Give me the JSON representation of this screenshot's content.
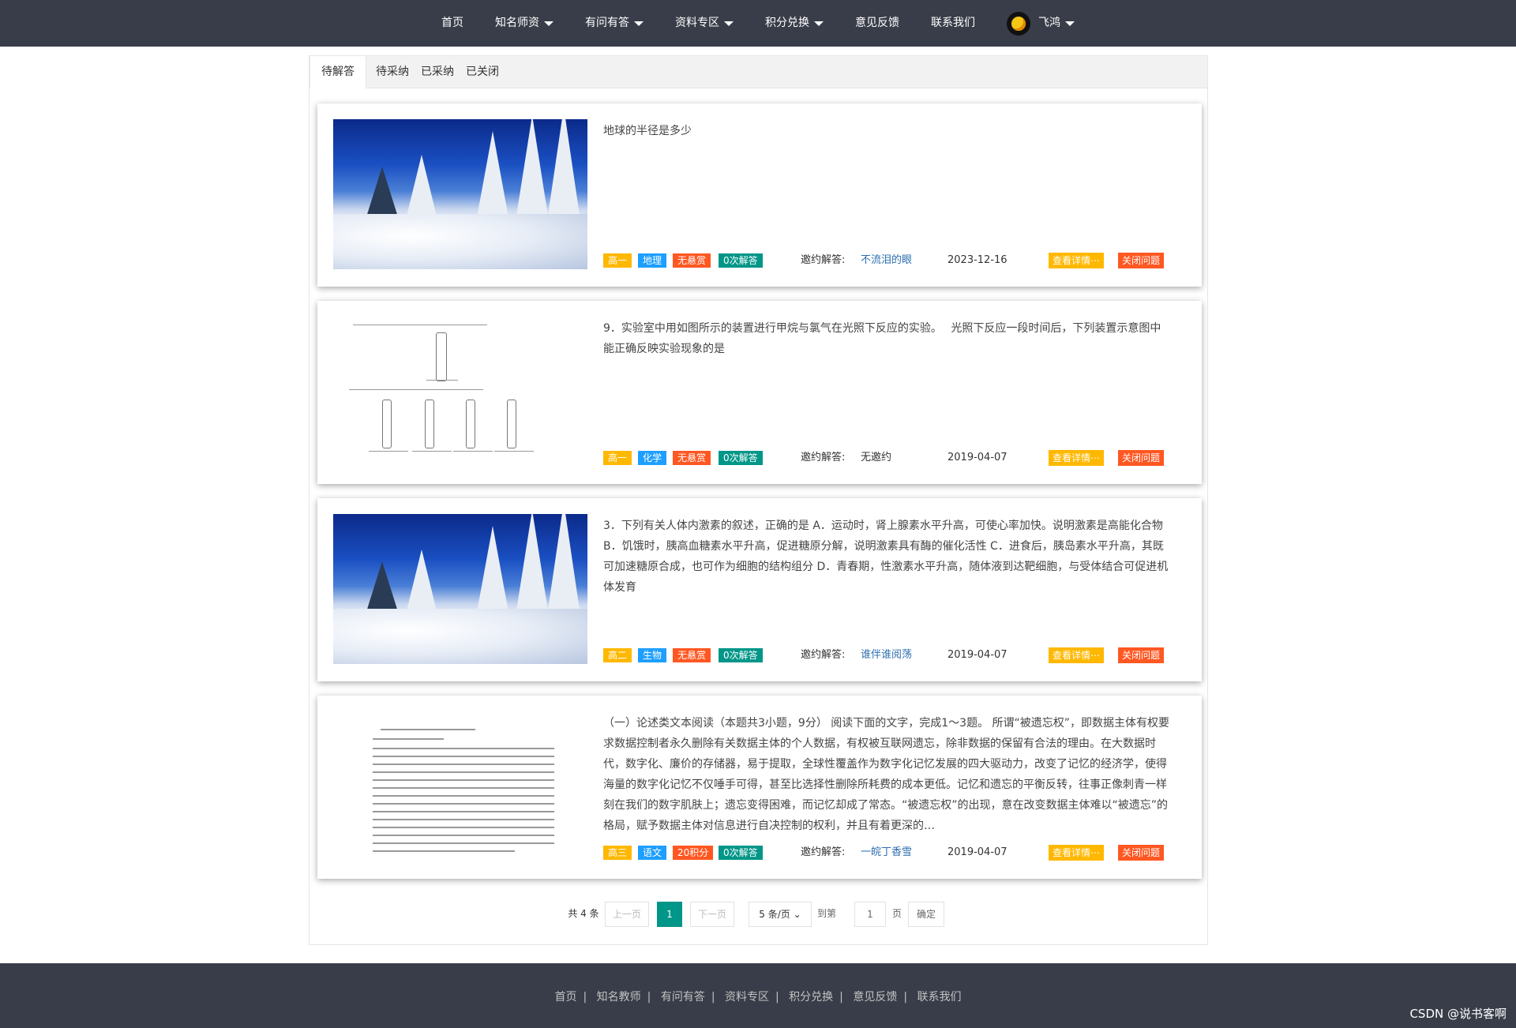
{
  "nav": {
    "items": [
      "首页",
      "知名师资",
      "有问有答",
      "资料专区",
      "积分兑换",
      "意见反馈",
      "联系我们"
    ],
    "user": "飞鸿"
  },
  "tabs": [
    "待解答",
    "待采纳",
    "已采纳",
    "已关闭"
  ],
  "labels": {
    "invite": "邀约解答:",
    "detail": "查看详情⋯",
    "close": "关闭问题"
  },
  "questions": [
    {
      "title": "地球的半径是多少",
      "tags": [
        "高一",
        "地理",
        "无悬赏",
        "0次解答"
      ],
      "invitee": "不流泪的眼",
      "date": "2023-12-16"
    },
    {
      "title": "9．实验室中用如图所示的装置进行甲烷与氯气在光照下反应的实验。　 光照下反应一段时间后，下列装置示意图中能正确反映实验现象的是",
      "tags": [
        "高一",
        "化学",
        "无悬赏",
        "0次解答"
      ],
      "invitee": "无邀约",
      "date": "2019-04-07"
    },
    {
      "title": "3．下列有关人体内激素的叙述，正确的是  A．运动时，肾上腺素水平升高，可使心率加快。说明激素是高能化合物 B．饥饿时，胰高血糖素水平升高，促进糖原分解，说明激素具有酶的催化活性 C．进食后，胰岛素水平升高，其既可加速糖原合成，也可作为细胞的结构组分 D．青春期，性激素水平升高，随体液到达靶细胞，与受体结合可促进机体发育",
      "tags": [
        "高二",
        "生物",
        "无悬赏",
        "0次解答"
      ],
      "invitee": "谁伴谁阅荡",
      "date": "2019-04-07"
    },
    {
      "title": "（一）论述类文本阅读（本题共3小题，9分） 阅读下面的文字，完成1～3题。 所谓“被遗忘权”，即数据主体有权要求数据控制者永久删除有关数据主体的个人数据，有权被互联网遗忘，除非数据的保留有合法的理由。在大数据时代，数字化、廉价的存储器，易于提取，全球性覆盖作为数字化记忆发展的四大驱动力，改变了记忆的经济学，使得海量的数字化记忆不仅唾手可得，甚至比选择性删除所耗费的成本更低。记忆和遗忘的平衡反转，往事正像刺青一样刻在我们的数字肌肤上；遗忘变得困难，而记忆却成了常态。“被遗忘权”的出现，意在改变数据主体难以“被遗忘”的格局，赋予数据主体对信息进行自决控制的权利，并且有着更深的…",
      "tags": [
        "高三",
        "语文",
        "20积分",
        "0次解答"
      ],
      "invitee": "一皖丁香雪",
      "date": "2019-04-07"
    }
  ],
  "pager": {
    "total": "共 4 条",
    "prev": "上一页",
    "current": "1",
    "next": "下一页",
    "per_page": "5 条/页",
    "goto": "到第",
    "page_input": "1",
    "page_unit": "页",
    "confirm": "确定"
  },
  "footer": [
    "首页",
    "知名教师",
    "有问有答",
    "资料专区",
    "积分兑换",
    "意见反馈",
    "联系我们"
  ],
  "watermark": "CSDN @说书客啊"
}
